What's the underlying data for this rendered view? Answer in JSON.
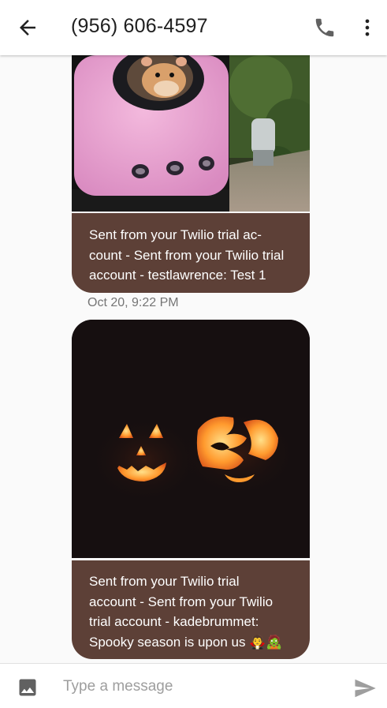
{
  "header": {
    "phone_number": "(956) 606-4597",
    "back_icon": "arrow-back-icon",
    "call_icon": "phone-icon",
    "menu_icon": "more-vert-icon"
  },
  "messages": [
    {
      "image_icon": "photo-hamster-backpack",
      "text_lines": [
        "Sent from your Twilio trial ac-",
        "count - Sent from your Twilio trial",
        "account - testlawrence: Test 1"
      ]
    },
    {
      "timestamp": "Oct 20, 9:22 PM",
      "image_icon": "photo-jack-o-lanterns",
      "text_lines": [
        "Sent from your Twilio trial",
        "account - Sent from your Twilio",
        "trial account - kadebrummet:",
        "Spooky season is upon us 🧛🧟"
      ]
    }
  ],
  "composer": {
    "placeholder": "Type a message",
    "attach_icon": "gallery-icon",
    "send_icon": "send-icon"
  },
  "colors": {
    "bubble": "#5d4037",
    "app_bar": "#ffffff",
    "background": "#fafafa"
  }
}
